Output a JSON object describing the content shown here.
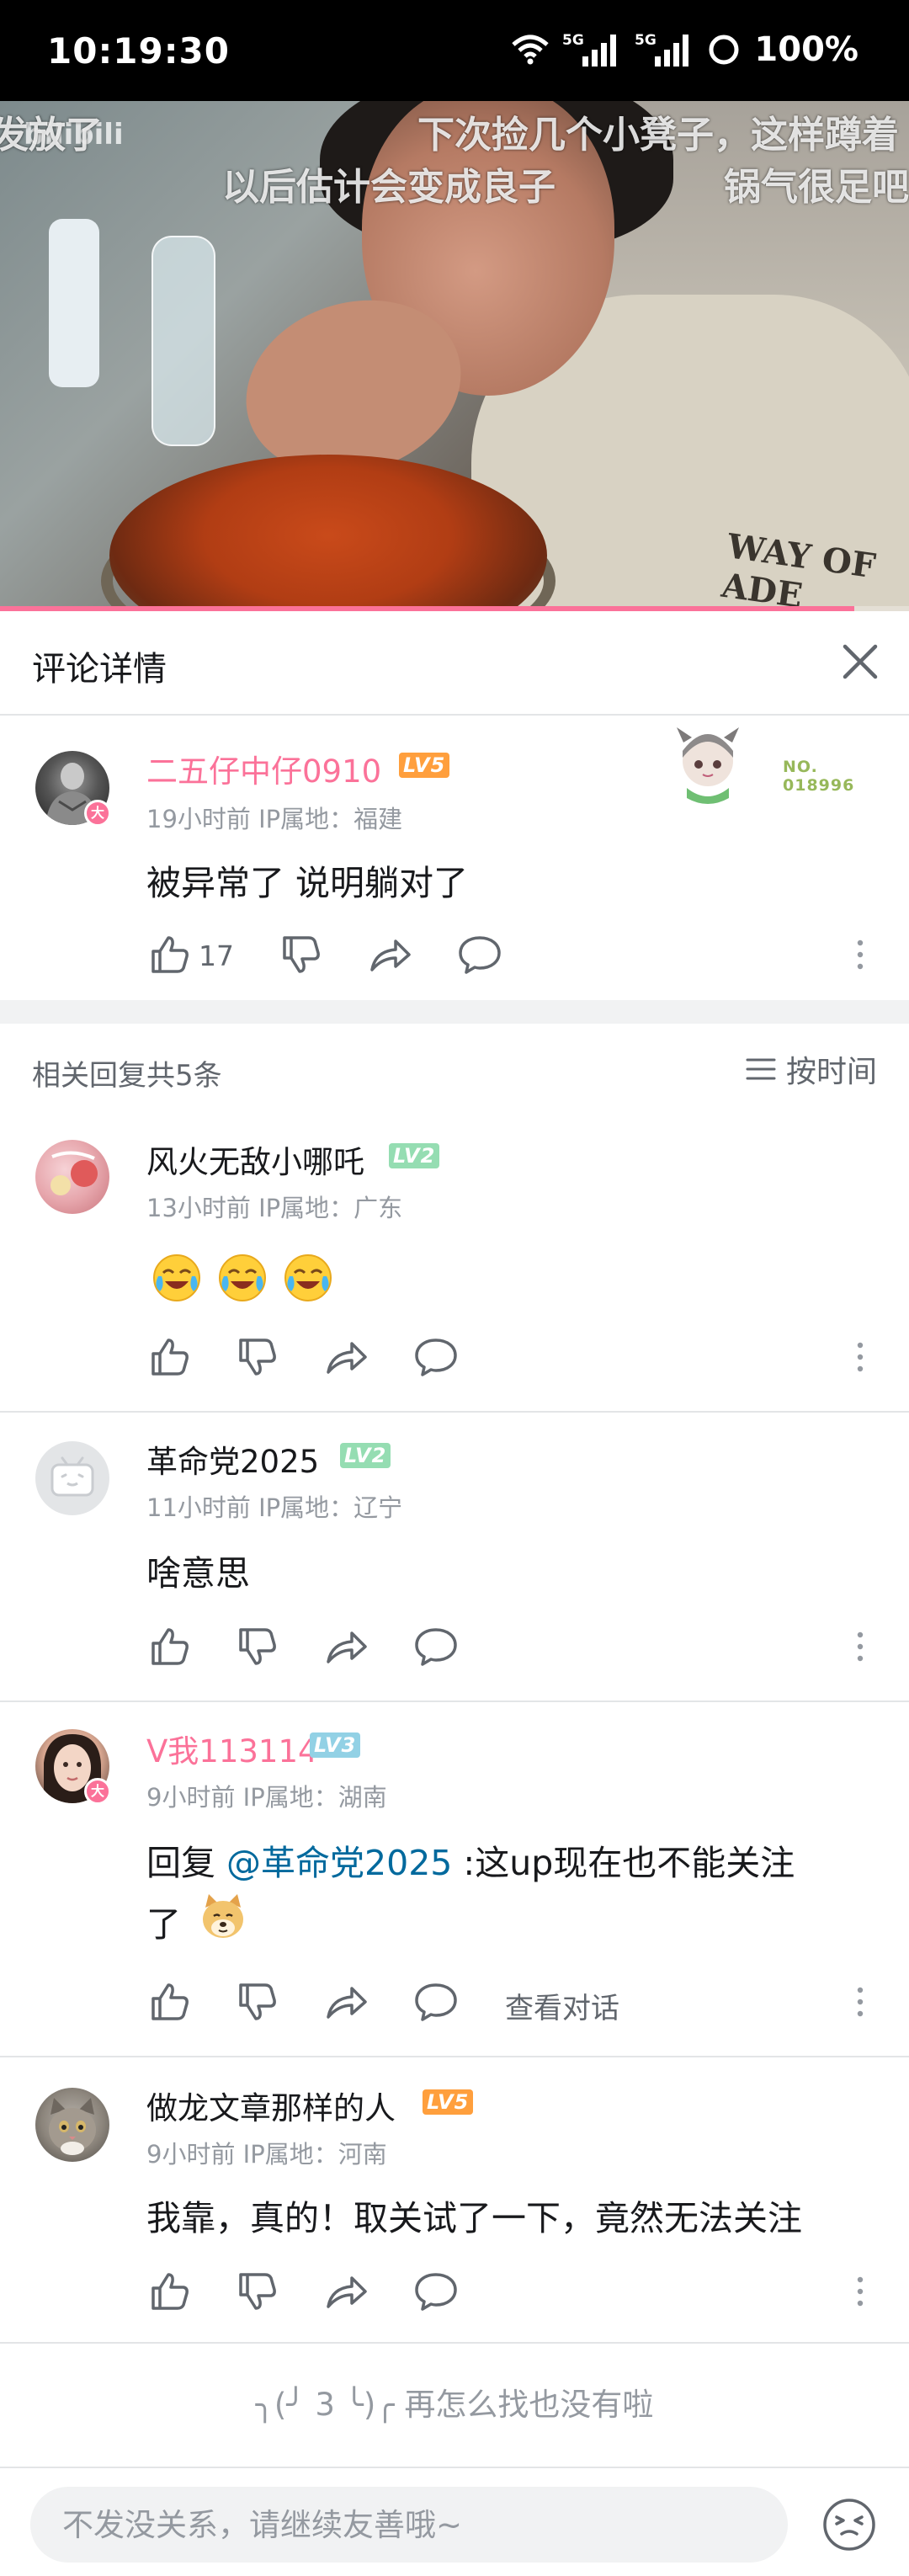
{
  "status_bar": {
    "time": "10:19:30",
    "network_1": "5G",
    "network_2": "5G",
    "battery": "100%"
  },
  "video": {
    "danmaku": [
      "下次捡几个小凳子，这样蹲着",
      "以后估计会变成良子",
      "锅气很足吧",
      "发放了"
    ],
    "watermark": "bilibili",
    "progress": 0.94
  },
  "panel": {
    "title": "评论详情"
  },
  "main_comment": {
    "username": "二五仔中仔0910",
    "level": "LV5",
    "time": "19小时前",
    "ip": "IP属地：福建",
    "content": "被异常了 说明躺对了",
    "likes": "17",
    "fan_badge_no": "NO.",
    "fan_badge_num": "018996",
    "badge": "大"
  },
  "replies_header": {
    "count_text": "相关回复共5条",
    "sort_label": "按时间"
  },
  "replies": [
    {
      "username": "风火无敌小哪吒",
      "level": "LV2",
      "time": "13小时前",
      "ip": "IP属地：广东",
      "content_emoji": [
        "crying-laugh-emoji",
        "crying-laugh-emoji",
        "crying-laugh-emoji"
      ]
    },
    {
      "username": "革命党2025",
      "level": "LV2",
      "time": "11小时前",
      "ip": "IP属地：辽宁",
      "content": "啥意思"
    },
    {
      "username": "V我113114",
      "level": "LV3",
      "time": "9小时前",
      "ip": "IP属地：湖南",
      "reply_prefix": "回复 ",
      "mention": "@革命党2025",
      "content_line1": " :这up现在也不能关注",
      "content_line2": "了",
      "view_conversation": "查看对话",
      "badge": "大"
    },
    {
      "username": "做龙文章那样的人",
      "level": "LV5",
      "time": "9小时前",
      "ip": "IP属地：河南",
      "content": "我靠，真的！取关试了一下，竟然无法关注"
    }
  ],
  "end_message": "╮(╯3╰)╭ 再怎么找也没有啦",
  "end_face": "╮(╯ 3 ╰)╭",
  "end_text": "再怎么找也没有啦",
  "input": {
    "placeholder": "不发没关系，请继续友善哦~"
  },
  "colors": {
    "accent_pink": "#fb7299",
    "lv2": "#95ddb2",
    "lv3": "#92d1e5",
    "lv5": "#ff9f3d",
    "mention": "#00699d"
  }
}
